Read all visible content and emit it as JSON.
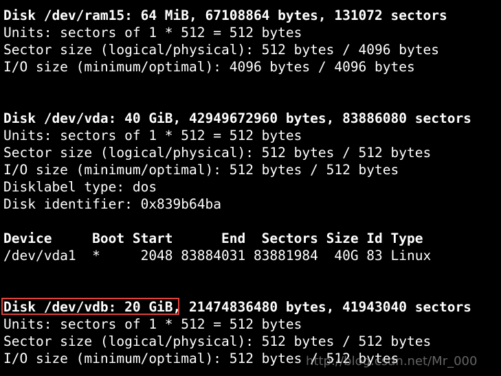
{
  "terminal": {
    "lines": [
      "Disk /dev/ram15: 64 MiB, 67108864 bytes, 131072 sectors",
      "Units: sectors of 1 * 512 = 512 bytes",
      "Sector size (logical/physical): 512 bytes / 4096 bytes",
      "I/O size (minimum/optimal): 4096 bytes / 4096 bytes",
      "",
      "",
      "Disk /dev/vda: 40 GiB, 42949672960 bytes, 83886080 sectors",
      "Units: sectors of 1 * 512 = 512 bytes",
      "Sector size (logical/physical): 512 bytes / 512 bytes",
      "I/O size (minimum/optimal): 512 bytes / 512 bytes",
      "Disklabel type: dos",
      "Disk identifier: 0x839b64ba",
      "",
      "Device     Boot Start      End  Sectors Size Id Type",
      "/dev/vda1  *     2048 83884031 83881984  40G 83 Linux",
      "",
      "",
      "Disk /dev/vdb: 20 GiB, 21474836480 bytes, 41943040 sectors",
      "Units: sectors of 1 * 512 = 512 bytes",
      "Sector size (logical/physical): 512 bytes / 512 bytes",
      "I/O size (minimum/optimal): 512 bytes / 512 bytes"
    ],
    "highlighted_text": "Disk /dev/vdb: 20 GiB",
    "colors": {
      "background": "#000000",
      "foreground": "#ffffff",
      "highlight_border": "#e0413a"
    }
  },
  "watermark": {
    "text": "http://blog.csdn.net/Mr_000"
  }
}
